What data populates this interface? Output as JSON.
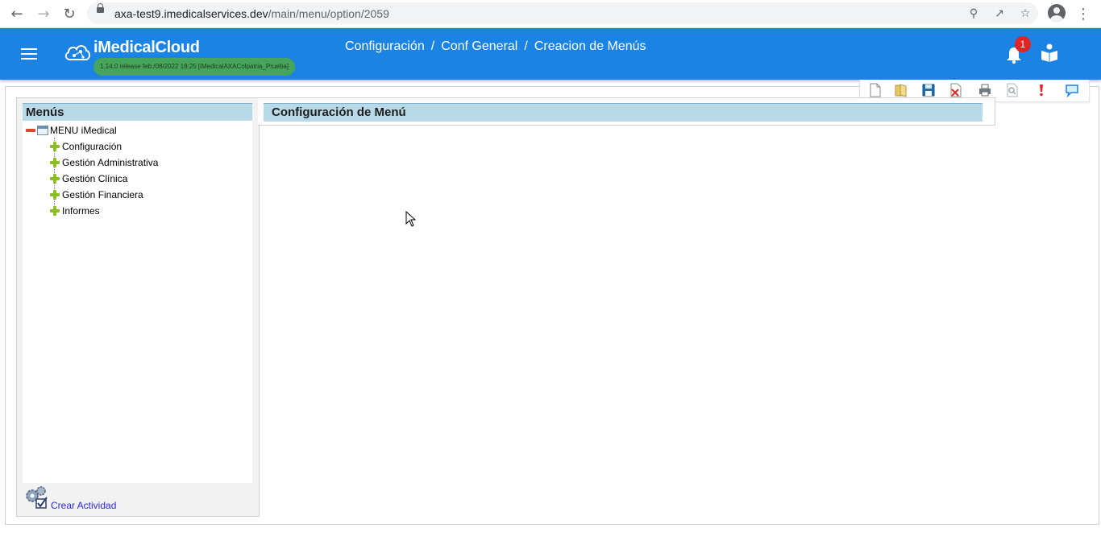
{
  "browser": {
    "url_host": "axa-test9.imedicalservices.dev",
    "url_path": "/main/menu/option/2059"
  },
  "header": {
    "brand": "iMedicalCloud",
    "version": "1.14.0 release feb./08/2022 18:25 [iMedicalAXAColpatria_Prueba]",
    "breadcrumb": [
      "Configuración",
      "Conf General",
      "Creacion de Menús"
    ],
    "breadcrumb_separator": "/",
    "notification_count": "1"
  },
  "toolbar": {
    "buttons": [
      "new-document-icon",
      "open-folder-icon",
      "save-icon",
      "delete-icon",
      "print-icon",
      "preview-icon",
      "help-icon",
      "comment-icon"
    ]
  },
  "menu_panel": {
    "title": "Menús",
    "root": "MENU iMedical",
    "items": [
      "Configuración",
      "Gestión Administrativa",
      "Gestión Clínica",
      "Gestión Financiera",
      "Informes"
    ],
    "action_label": "Crear Actividad"
  },
  "config_panel": {
    "title": "Configuración de Menú"
  },
  "colors": {
    "header_blue": "#1b83e3",
    "badge_green": "#46a55a",
    "panel_header": "#b8d9e8",
    "notification_red": "#e02424"
  }
}
